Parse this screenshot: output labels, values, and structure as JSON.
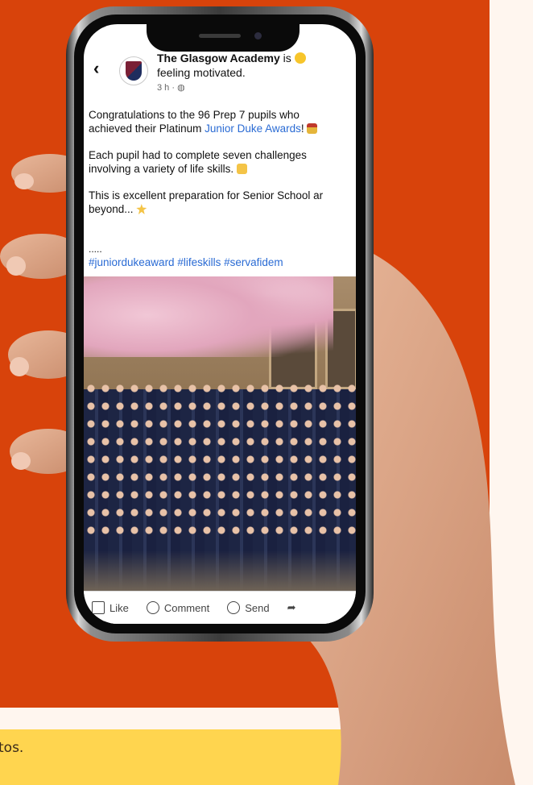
{
  "post": {
    "author": "The Glasgow Academy",
    "activity_prefix": "is",
    "activity": "feeling motivated.",
    "time": "3 h · ",
    "line1": "Congratulations to the 96 Prep 7 pupils who",
    "line2_prefix": "achieved their Platinum ",
    "line2_link": "Junior Duke Awards",
    "line2_suffix": "!",
    "para2_line1": "Each pupil had to complete seven challenges",
    "para2_line2": "involving a variety of life skills.",
    "para3_line1": "This is excellent preparation for Senior School ar",
    "para3_line2": "beyond...",
    "dots": ".....",
    "hashtags": "#juniordukeaward #lifeskills #servafidem"
  },
  "actions": {
    "like": "Like",
    "comment": "Comment",
    "send": "Send"
  },
  "footer_text": "tos.",
  "colors": {
    "orange": "#d8430b",
    "yellow": "#ffd54f",
    "cream": "#fff6ef",
    "link": "#2a6bd4"
  },
  "icons": [
    "back-chevron-icon",
    "globe-icon",
    "smile-emoji-icon",
    "medal-emoji-icon",
    "raised-hands-emoji-icon",
    "star-emoji-icon",
    "like-icon",
    "comment-icon",
    "send-icon",
    "share-icon"
  ]
}
